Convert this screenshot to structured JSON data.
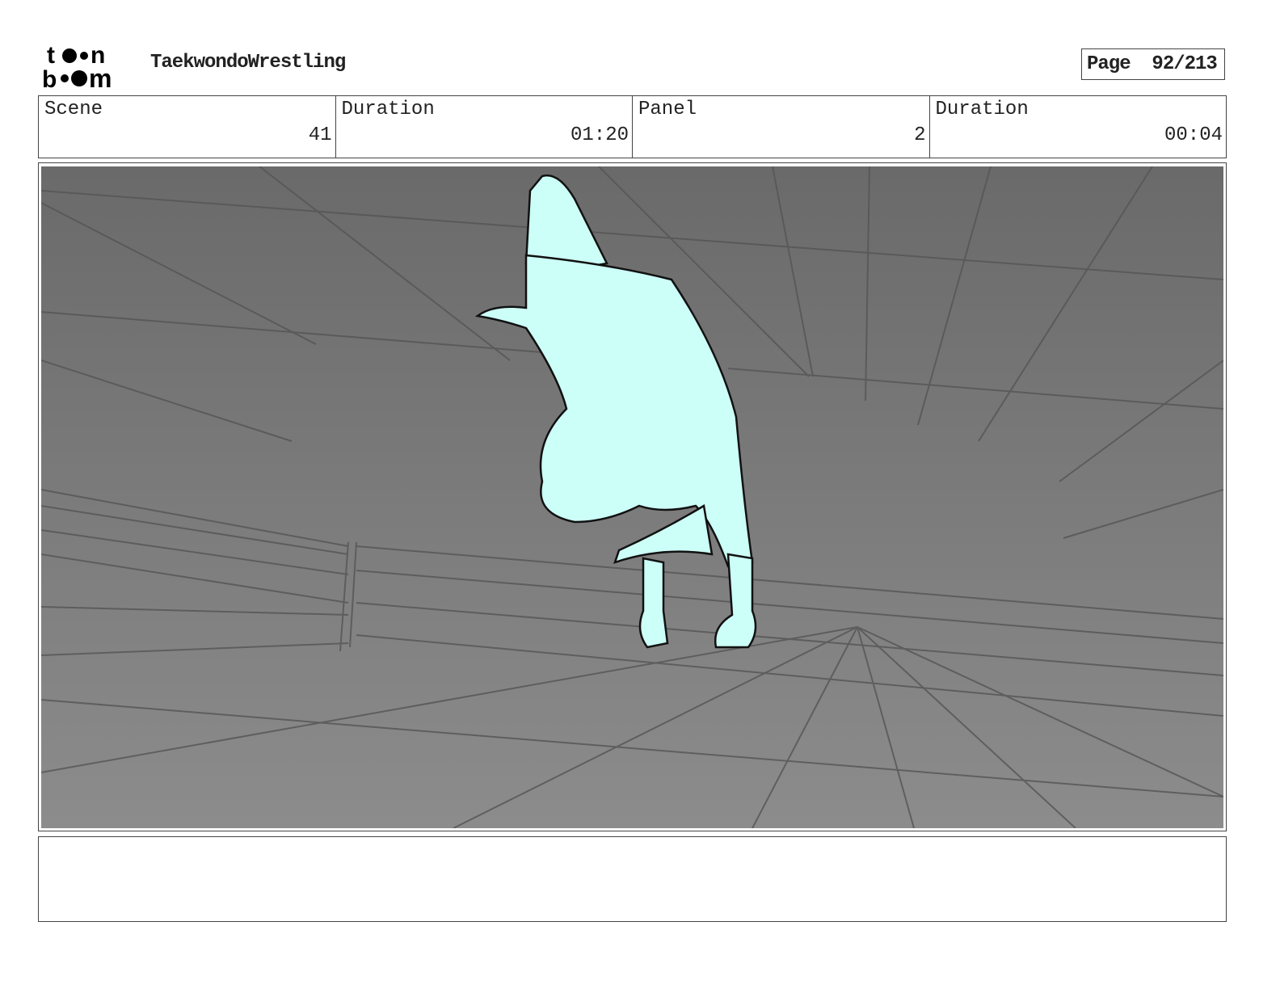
{
  "header": {
    "logo_text": "toon boom",
    "project_title": "TaekwondoWrestling",
    "page_label": "Page",
    "page_value": "92/213"
  },
  "info": {
    "scene_label": "Scene",
    "scene_value": "41",
    "scene_duration_label": "Duration",
    "scene_duration_value": "01:20",
    "panel_label": "Panel",
    "panel_value": "2",
    "panel_duration_label": "Duration",
    "panel_duration_value": "00:04"
  },
  "colors": {
    "character_fill": "#ccfff8",
    "background_top": "#6a6a6a",
    "background_bottom": "#8c8c8c"
  }
}
